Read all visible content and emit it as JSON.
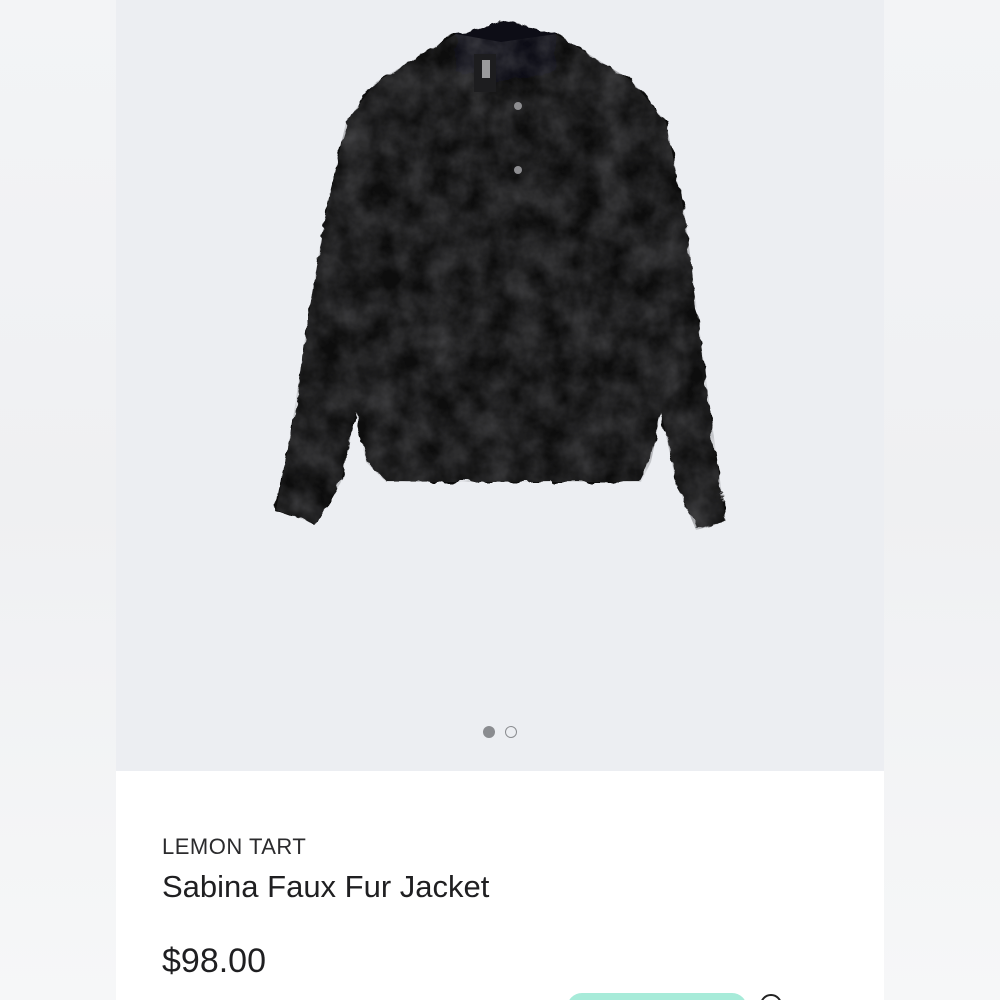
{
  "product": {
    "brand": "LEMON TART",
    "name": "Sabina Faux Fur Jacket",
    "price": "$98.00",
    "image": {
      "description_icon": "jacket-image",
      "carousel": {
        "total": 2,
        "active_index": 0
      }
    }
  },
  "partial_row": {
    "text": "",
    "pill_color": "#a7ebd9",
    "icon": "info-icon"
  },
  "colors": {
    "accent_mint": "#a7ebd9",
    "text_dark": "#1f1f21",
    "dot_gray": "#8a8c90"
  }
}
